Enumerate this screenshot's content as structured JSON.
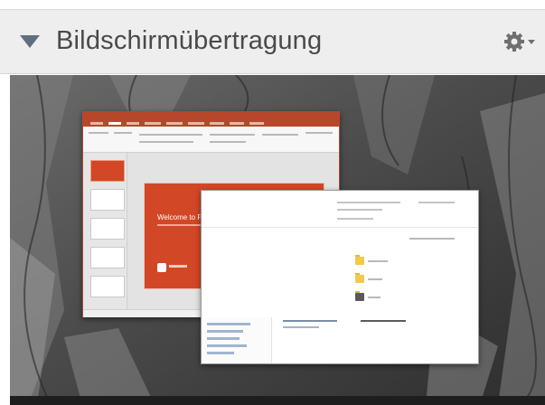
{
  "panel": {
    "title": "Bildschirmübertragung",
    "collapse_icon": "triangle-down-icon",
    "settings_icon": "gear-icon",
    "settings_dropdown_icon": "chevron-down-icon"
  },
  "screen_share": {
    "description_icon": "desktop-screenshare",
    "slide": {
      "title": "Welcome to PowerPoint"
    }
  },
  "colors": {
    "header_bg": "#eeeeee",
    "title_text": "#4a4a4a",
    "icon": "#6f6f6f",
    "powerpoint_accent": "#d24726"
  }
}
